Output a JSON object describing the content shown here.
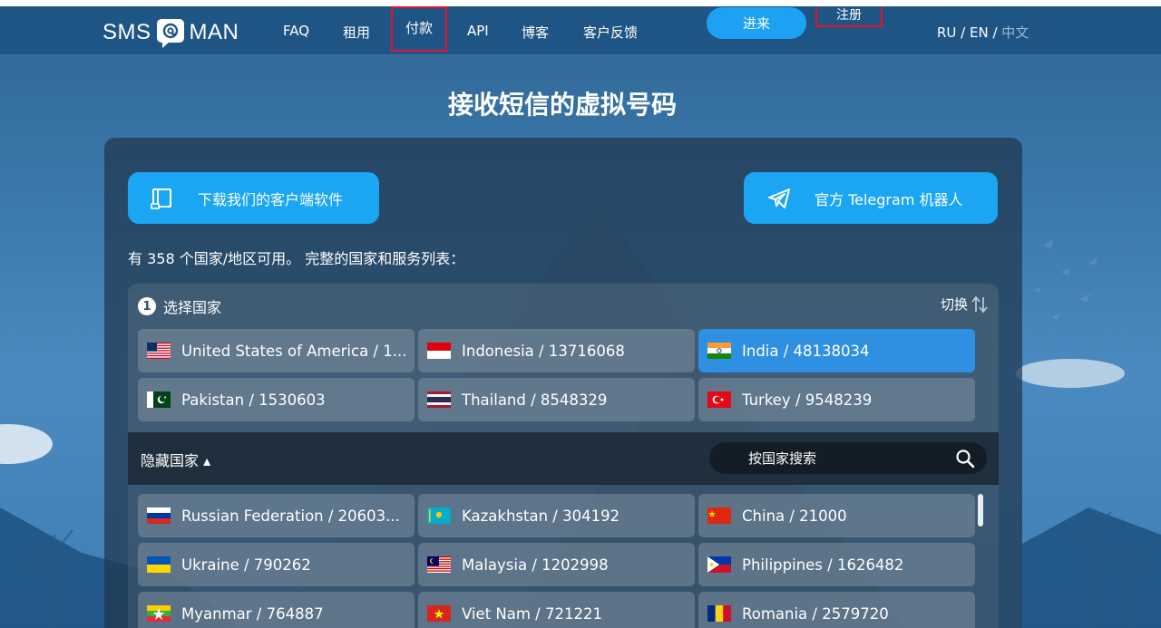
{
  "header": {
    "logo_left": "SMS",
    "logo_right": "MAN",
    "nav": [
      {
        "label": "FAQ",
        "highlighted": false
      },
      {
        "label": "租用",
        "highlighted": false
      },
      {
        "label": "付款",
        "highlighted": true
      },
      {
        "label": "API",
        "highlighted": false
      },
      {
        "label": "博客",
        "highlighted": false
      },
      {
        "label": "客户反馈",
        "highlighted": false
      }
    ],
    "login_label": "进来",
    "register_label": "注册",
    "lang": {
      "ru": "RU",
      "sep1": " / ",
      "en": "EN",
      "sep2": " / ",
      "zh": "中文",
      "active": "zh"
    }
  },
  "page_title": "接收短信的虚拟号码",
  "card": {
    "download_label": "下载我们的客户端软件",
    "telegram_label": "官方 Telegram 机器人",
    "available_text": "有 358 个国家/地区可用。 完整的国家和服务列表：",
    "step_number": "1",
    "step_label": "选择国家",
    "switch_label": "切换",
    "top_countries": [
      {
        "label": "United States of America / 1...",
        "flag": "us"
      },
      {
        "label": "Indonesia / 13716068",
        "flag": "id"
      },
      {
        "label": "India / 48138034",
        "flag": "in",
        "selected": true
      },
      {
        "label": "Pakistan / 1530603",
        "flag": "pk"
      },
      {
        "label": "Thailand / 8548329",
        "flag": "th"
      },
      {
        "label": "Turkey / 9548239",
        "flag": "tr"
      }
    ],
    "hidden_label": "隐藏国家 ▴",
    "search_placeholder": "按国家搜索",
    "countries": [
      {
        "label": "Russian Federation / 20603...",
        "flag": "ru"
      },
      {
        "label": "Kazakhstan / 304192",
        "flag": "kz"
      },
      {
        "label": "China / 21000",
        "flag": "cn"
      },
      {
        "label": "Ukraine / 790262",
        "flag": "ua"
      },
      {
        "label": "Malaysia / 1202998",
        "flag": "my"
      },
      {
        "label": "Philippines / 1626482",
        "flag": "ph"
      },
      {
        "label": "Myanmar / 764887",
        "flag": "mm"
      },
      {
        "label": "Viet Nam / 721221",
        "flag": "vn"
      },
      {
        "label": "Romania / 2579720",
        "flag": "ro"
      }
    ]
  },
  "colors": {
    "accent": "#1aa6f3",
    "selected": "#2f8fe0",
    "highlight_box": "#e8102a",
    "header": "#1f5585"
  }
}
